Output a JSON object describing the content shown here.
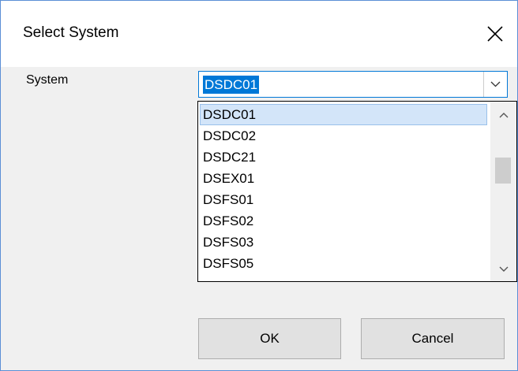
{
  "dialog": {
    "title": "Select System",
    "close_icon": "close-icon"
  },
  "form": {
    "system_label": "System",
    "system_value": "DSDC01"
  },
  "dropdown": {
    "items": [
      "DSDC01",
      "DSDC02",
      "DSDC21",
      "DSEX01",
      "DSFS01",
      "DSFS02",
      "DSFS03",
      "DSFS05"
    ],
    "selected_index": 0
  },
  "buttons": {
    "ok": "OK",
    "cancel": "Cancel"
  },
  "colors": {
    "accent": "#0078d7",
    "selection_highlight": "#d3e5f9",
    "dialog_bg": "#f0f0f0"
  }
}
